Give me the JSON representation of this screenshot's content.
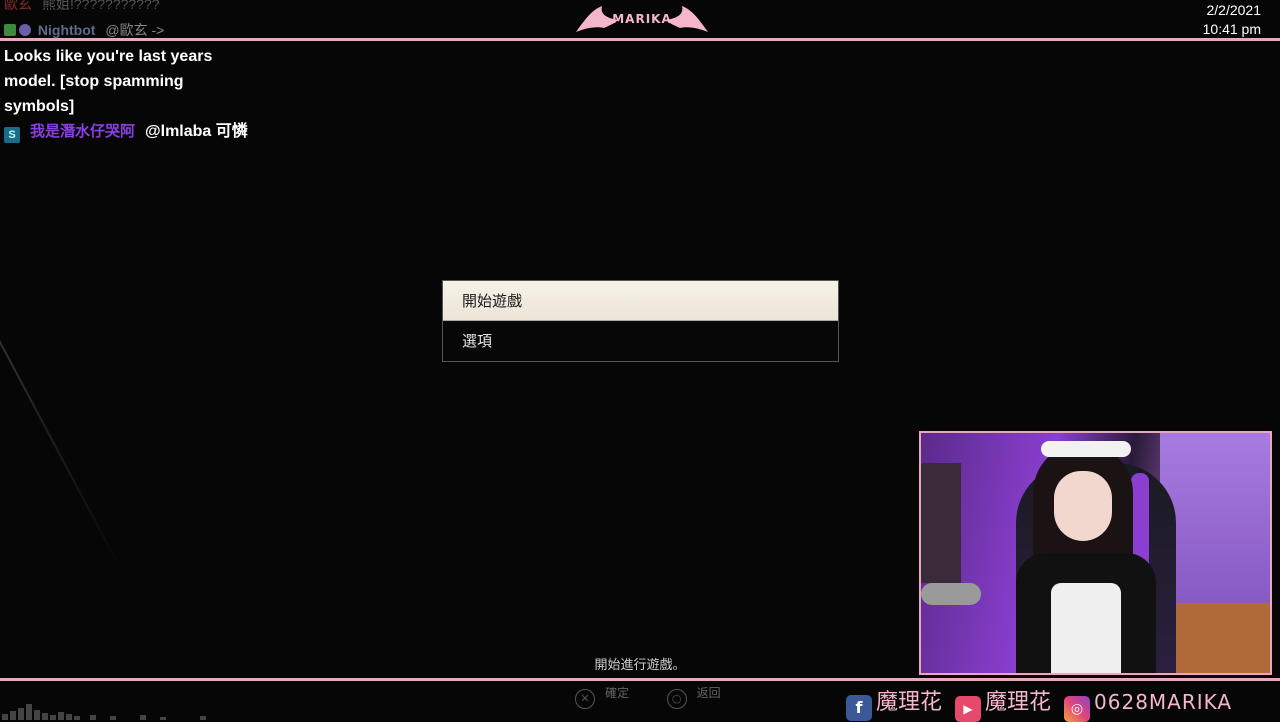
{
  "overlay": {
    "logo_text": "MARIKA",
    "date": "2/2/2021",
    "time": "10:41 pm",
    "accent_color": "#e7a8bf"
  },
  "chat": {
    "faded_row": {
      "user": "歐玄",
      "text": "熊姐!???????????"
    },
    "bot_row": {
      "user": "Nightbot",
      "text": "@歐玄 ->"
    },
    "bot_message": "Looks like you're last years model. [stop spamming symbols]",
    "user_row": {
      "badge": "S",
      "user": "我是潛水仔哭阿",
      "text": "@lmlaba 可憐"
    }
  },
  "game_menu": {
    "items": [
      {
        "label": "開始遊戲",
        "selected": true
      },
      {
        "label": "選項",
        "selected": false
      }
    ],
    "hint": "開始進行遊戲。",
    "controls": [
      {
        "icon": "cross-button-icon",
        "label": "確定"
      },
      {
        "icon": "circle-button-icon",
        "label": "返回"
      }
    ]
  },
  "socials": [
    {
      "icon": "facebook-icon",
      "label": "魔理花"
    },
    {
      "icon": "youtube-icon",
      "label": "魔理花"
    },
    {
      "icon": "instagram-icon",
      "label": "0628MARIKA"
    }
  ]
}
